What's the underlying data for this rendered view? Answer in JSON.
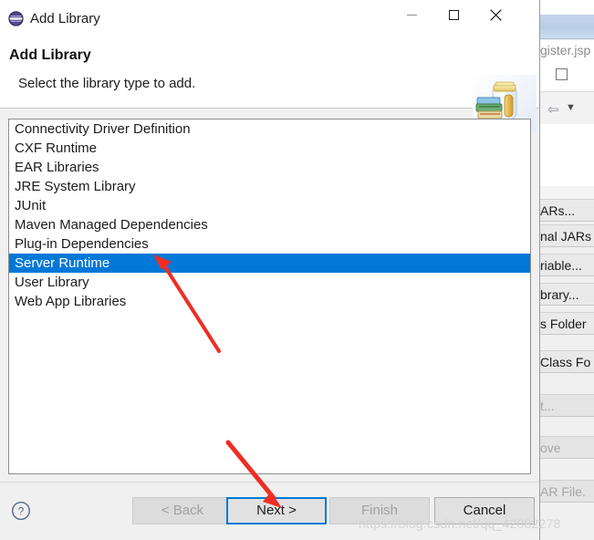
{
  "window": {
    "title": "Add Library",
    "icon": "eclipse-sphere-icon",
    "controls": {
      "minimize": "minimize-icon",
      "maximize": "maximize-icon",
      "close": "close-icon"
    }
  },
  "header": {
    "title": "Add Library",
    "subtitle": "Select the library type to add.",
    "banner_icon": "library-jar-books-icon"
  },
  "library_list": {
    "items": [
      {
        "label": "Connectivity Driver Definition",
        "selected": false
      },
      {
        "label": "CXF Runtime",
        "selected": false
      },
      {
        "label": "EAR Libraries",
        "selected": false
      },
      {
        "label": "JRE System Library",
        "selected": false
      },
      {
        "label": "JUnit",
        "selected": false
      },
      {
        "label": "Maven Managed Dependencies",
        "selected": false
      },
      {
        "label": "Plug-in Dependencies",
        "selected": false
      },
      {
        "label": "Server Runtime",
        "selected": true
      },
      {
        "label": "User Library",
        "selected": false
      },
      {
        "label": "Web App Libraries",
        "selected": false
      }
    ],
    "selected_value": "Server Runtime"
  },
  "buttons": {
    "help": "help-icon",
    "back": {
      "label": "< Back",
      "enabled": false,
      "focused": false
    },
    "next": {
      "label": "Next >",
      "enabled": true,
      "focused": true
    },
    "finish": {
      "label": "Finish",
      "enabled": false,
      "focused": false
    },
    "cancel": {
      "label": "Cancel",
      "enabled": true,
      "focused": false
    }
  },
  "watermark": {
    "text": "https://blog.csdn.net/qq_42082278"
  },
  "background_window": {
    "tab_label": "gister.jsp",
    "buildpath_buttons": [
      {
        "label": "ARs...",
        "enabled": true
      },
      {
        "label": "nal JARs",
        "enabled": true
      },
      {
        "label": "riable...",
        "enabled": true
      },
      {
        "label": "brary...",
        "enabled": true
      },
      {
        "label": "s Folder",
        "enabled": true
      },
      {
        "label": "Class Fo",
        "enabled": true
      },
      {
        "label": "t...",
        "enabled": false
      },
      {
        "label": "ove",
        "enabled": false
      },
      {
        "label": "AR File.",
        "enabled": false
      }
    ]
  },
  "annotations": {
    "arrow_to_selection": "red-arrow-pointing-to-server-runtime",
    "arrow_to_next": "red-arrow-pointing-to-next-button"
  },
  "colors": {
    "selection_blue": "#0078d7",
    "focus_blue": "#0078d7",
    "annotation_red": "#ee2e24",
    "dialog_face": "#f0f0f0"
  }
}
